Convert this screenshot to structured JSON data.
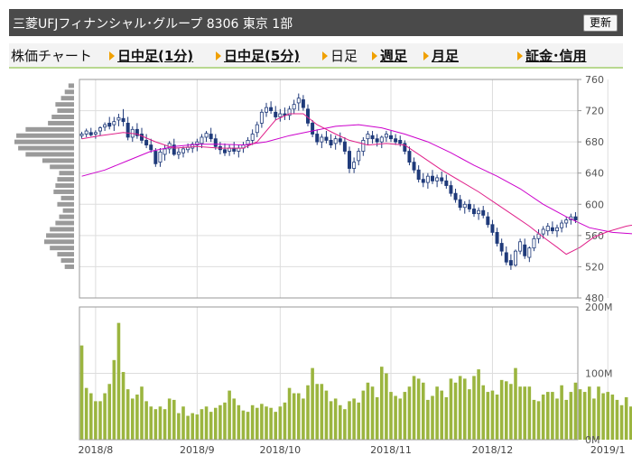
{
  "header": {
    "title": "三菱UFJフィナンシャル･グループ 8306 東京 1部",
    "update_label": "更新"
  },
  "tabs": [
    {
      "label": "株価チャート",
      "link": false
    },
    {
      "label": "日中足(1分)",
      "link": true
    },
    {
      "label": "日中足(5分)",
      "link": true
    },
    {
      "label": "日足",
      "link": false
    },
    {
      "label": "週足",
      "link": true
    },
    {
      "label": "月足",
      "link": true
    },
    {
      "label": "証金･信用",
      "link": true
    }
  ],
  "colors": {
    "up": "#ffffff",
    "down": "#1f3a7a",
    "short_ma": "#e0218a",
    "long_ma": "#cc00cc",
    "volume": "#9bb53f",
    "volume_profile": "#9a9a9a",
    "grid": "#dddddd",
    "axis": "#999999"
  },
  "chart_data": {
    "type": "candlestick",
    "price_axis": {
      "min": 480,
      "max": 760,
      "ticks": [
        "760",
        "720",
        "680",
        "640",
        "600",
        "560",
        "520",
        "480"
      ]
    },
    "volume_axis": {
      "min": 0,
      "max": 200,
      "unit": "M",
      "ticks": [
        "200M",
        "100M",
        "0M"
      ]
    },
    "x_ticks": [
      "2018/8",
      "2018/9",
      "2018/10",
      "2018/11",
      "2018/12",
      "2019/1"
    ],
    "x_tick_index": [
      3,
      25,
      43,
      67,
      89,
      114
    ],
    "grid": true,
    "candles": [
      [
        688,
        693,
        684,
        690
      ],
      [
        690,
        697,
        686,
        694
      ],
      [
        692,
        698,
        687,
        689
      ],
      [
        690,
        695,
        684,
        692
      ],
      [
        694,
        700,
        688,
        698
      ],
      [
        699,
        705,
        694,
        702
      ],
      [
        704,
        712,
        696,
        700
      ],
      [
        702,
        712,
        694,
        706
      ],
      [
        708,
        716,
        700,
        711
      ],
      [
        710,
        722,
        700,
        706
      ],
      [
        704,
        712,
        682,
        686
      ],
      [
        686,
        700,
        680,
        696
      ],
      [
        696,
        704,
        684,
        688
      ],
      [
        690,
        698,
        678,
        682
      ],
      [
        682,
        690,
        672,
        676
      ],
      [
        676,
        684,
        666,
        670
      ],
      [
        668,
        672,
        648,
        652
      ],
      [
        654,
        672,
        648,
        667
      ],
      [
        664,
        676,
        656,
        671
      ],
      [
        671,
        681,
        665,
        678
      ],
      [
        676,
        684,
        662,
        664
      ],
      [
        664,
        672,
        658,
        667
      ],
      [
        666,
        674,
        660,
        671
      ],
      [
        670,
        678,
        666,
        673
      ],
      [
        672,
        680,
        666,
        677
      ],
      [
        676,
        684,
        668,
        680
      ],
      [
        678,
        690,
        672,
        686
      ],
      [
        686,
        694,
        680,
        691
      ],
      [
        690,
        698,
        680,
        684
      ],
      [
        684,
        690,
        670,
        674
      ],
      [
        674,
        680,
        664,
        670
      ],
      [
        670,
        678,
        662,
        666
      ],
      [
        668,
        676,
        662,
        672
      ],
      [
        672,
        680,
        664,
        668
      ],
      [
        668,
        676,
        660,
        672
      ],
      [
        672,
        680,
        666,
        676
      ],
      [
        676,
        686,
        672,
        682
      ],
      [
        682,
        696,
        676,
        690
      ],
      [
        692,
        706,
        686,
        702
      ],
      [
        704,
        722,
        698,
        718
      ],
      [
        718,
        730,
        712,
        724
      ],
      [
        724,
        732,
        716,
        720
      ],
      [
        718,
        726,
        708,
        712
      ],
      [
        712,
        722,
        706,
        716
      ],
      [
        716,
        724,
        708,
        714
      ],
      [
        714,
        726,
        708,
        722
      ],
      [
        722,
        734,
        716,
        728
      ],
      [
        730,
        742,
        720,
        736
      ],
      [
        734,
        740,
        720,
        724
      ],
      [
        722,
        728,
        700,
        704
      ],
      [
        704,
        708,
        686,
        690
      ],
      [
        690,
        696,
        676,
        680
      ],
      [
        680,
        690,
        672,
        686
      ],
      [
        686,
        694,
        678,
        682
      ],
      [
        682,
        690,
        672,
        676
      ],
      [
        678,
        688,
        670,
        684
      ],
      [
        684,
        692,
        676,
        680
      ],
      [
        680,
        686,
        664,
        668
      ],
      [
        668,
        674,
        640,
        646
      ],
      [
        646,
        660,
        640,
        654
      ],
      [
        656,
        672,
        650,
        668
      ],
      [
        668,
        686,
        662,
        682
      ],
      [
        684,
        694,
        676,
        690
      ],
      [
        688,
        694,
        678,
        684
      ],
      [
        684,
        690,
        674,
        680
      ],
      [
        680,
        688,
        672,
        686
      ],
      [
        686,
        694,
        680,
        690
      ],
      [
        688,
        694,
        680,
        684
      ],
      [
        684,
        690,
        676,
        680
      ],
      [
        682,
        688,
        674,
        678
      ],
      [
        678,
        682,
        664,
        668
      ],
      [
        668,
        674,
        650,
        654
      ],
      [
        654,
        660,
        640,
        644
      ],
      [
        644,
        650,
        628,
        632
      ],
      [
        632,
        640,
        622,
        628
      ],
      [
        628,
        640,
        620,
        636
      ],
      [
        636,
        644,
        626,
        630
      ],
      [
        630,
        638,
        622,
        634
      ],
      [
        634,
        642,
        626,
        630
      ],
      [
        630,
        638,
        620,
        624
      ],
      [
        624,
        630,
        610,
        614
      ],
      [
        614,
        620,
        602,
        606
      ],
      [
        606,
        612,
        592,
        596
      ],
      [
        596,
        604,
        588,
        600
      ],
      [
        600,
        606,
        590,
        594
      ],
      [
        594,
        600,
        584,
        588
      ],
      [
        588,
        596,
        580,
        592
      ],
      [
        592,
        598,
        582,
        586
      ],
      [
        584,
        590,
        570,
        574
      ],
      [
        574,
        580,
        560,
        564
      ],
      [
        564,
        570,
        546,
        550
      ],
      [
        550,
        556,
        534,
        540
      ],
      [
        538,
        546,
        522,
        526
      ],
      [
        528,
        536,
        516,
        522
      ],
      [
        522,
        542,
        520,
        540
      ],
      [
        540,
        556,
        536,
        552
      ],
      [
        548,
        556,
        530,
        534
      ],
      [
        532,
        546,
        526,
        544
      ],
      [
        544,
        560,
        540,
        556
      ],
      [
        556,
        568,
        550,
        562
      ],
      [
        562,
        572,
        556,
        568
      ],
      [
        566,
        576,
        560,
        572
      ],
      [
        570,
        578,
        562,
        566
      ],
      [
        566,
        574,
        558,
        570
      ],
      [
        570,
        580,
        564,
        576
      ],
      [
        576,
        584,
        570,
        580
      ],
      [
        580,
        588,
        574,
        584
      ],
      [
        584,
        590,
        576,
        580
      ]
    ],
    "short_ma": [
      [
        0,
        684
      ],
      [
        4,
        688
      ],
      [
        9,
        692
      ],
      [
        12,
        690
      ],
      [
        16,
        680
      ],
      [
        20,
        672
      ],
      [
        25,
        674
      ],
      [
        30,
        672
      ],
      [
        35,
        672
      ],
      [
        38,
        680
      ],
      [
        42,
        708
      ],
      [
        45,
        716
      ],
      [
        48,
        716
      ],
      [
        51,
        702
      ],
      [
        55,
        690
      ],
      [
        58,
        682
      ],
      [
        62,
        676
      ],
      [
        66,
        678
      ],
      [
        70,
        676
      ],
      [
        74,
        660
      ],
      [
        78,
        644
      ],
      [
        82,
        630
      ],
      [
        86,
        616
      ],
      [
        90,
        600
      ],
      [
        94,
        584
      ],
      [
        97,
        572
      ],
      [
        100,
        558
      ],
      [
        103,
        545
      ],
      [
        105,
        536
      ],
      [
        108,
        545
      ],
      [
        111,
        558
      ],
      [
        114,
        565
      ],
      [
        118,
        572
      ],
      [
        121,
        575
      ],
      [
        124,
        578
      ]
    ],
    "long_ma": [
      [
        0,
        636
      ],
      [
        5,
        644
      ],
      [
        10,
        656
      ],
      [
        15,
        668
      ],
      [
        20,
        674
      ],
      [
        25,
        677
      ],
      [
        30,
        677
      ],
      [
        35,
        676
      ],
      [
        40,
        680
      ],
      [
        45,
        688
      ],
      [
        50,
        694
      ],
      [
        55,
        700
      ],
      [
        60,
        702
      ],
      [
        65,
        698
      ],
      [
        70,
        690
      ],
      [
        75,
        680
      ],
      [
        80,
        666
      ],
      [
        85,
        650
      ],
      [
        90,
        636
      ],
      [
        95,
        620
      ],
      [
        100,
        600
      ],
      [
        105,
        584
      ],
      [
        110,
        570
      ],
      [
        115,
        564
      ],
      [
        120,
        562
      ],
      [
        124,
        561
      ]
    ],
    "volume": [
      142,
      78,
      70,
      58,
      58,
      70,
      84,
      120,
      176,
      102,
      76,
      62,
      68,
      80,
      58,
      50,
      46,
      50,
      46,
      62,
      60,
      40,
      50,
      36,
      40,
      38,
      46,
      50,
      42,
      48,
      52,
      56,
      74,
      62,
      52,
      44,
      42,
      52,
      48,
      54,
      50,
      48,
      42,
      50,
      56,
      78,
      70,
      70,
      62,
      82,
      108,
      84,
      84,
      74,
      58,
      62,
      52,
      46,
      58,
      62,
      56,
      74,
      86,
      80,
      64,
      110,
      100,
      72,
      66,
      62,
      72,
      80,
      96,
      92,
      86,
      60,
      66,
      80,
      74,
      64,
      92,
      86,
      96,
      92,
      76,
      96,
      106,
      82,
      72,
      74,
      68,
      90,
      88,
      84,
      108,
      80,
      80,
      80,
      60,
      58,
      68,
      72,
      72,
      62,
      82,
      60,
      72,
      86,
      76,
      72,
      80,
      62,
      80,
      70,
      72,
      68,
      60,
      52,
      64,
      50
    ],
    "volume_profile": [
      {
        "price": 752,
        "len": 6
      },
      {
        "price": 744,
        "len": 10
      },
      {
        "price": 736,
        "len": 14
      },
      {
        "price": 728,
        "len": 20
      },
      {
        "price": 720,
        "len": 18
      },
      {
        "price": 712,
        "len": 24
      },
      {
        "price": 704,
        "len": 28
      },
      {
        "price": 696,
        "len": 52
      },
      {
        "price": 688,
        "len": 62
      },
      {
        "price": 680,
        "len": 64
      },
      {
        "price": 672,
        "len": 60
      },
      {
        "price": 664,
        "len": 52
      },
      {
        "price": 656,
        "len": 34
      },
      {
        "price": 648,
        "len": 26
      },
      {
        "price": 640,
        "len": 16
      },
      {
        "price": 632,
        "len": 18
      },
      {
        "price": 624,
        "len": 20
      },
      {
        "price": 616,
        "len": 22
      },
      {
        "price": 608,
        "len": 14
      },
      {
        "price": 600,
        "len": 18
      },
      {
        "price": 592,
        "len": 12
      },
      {
        "price": 584,
        "len": 16
      },
      {
        "price": 576,
        "len": 20
      },
      {
        "price": 568,
        "len": 26
      },
      {
        "price": 560,
        "len": 30
      },
      {
        "price": 552,
        "len": 32
      },
      {
        "price": 544,
        "len": 26
      },
      {
        "price": 536,
        "len": 18
      },
      {
        "price": 528,
        "len": 14
      },
      {
        "price": 520,
        "len": 10
      }
    ]
  }
}
